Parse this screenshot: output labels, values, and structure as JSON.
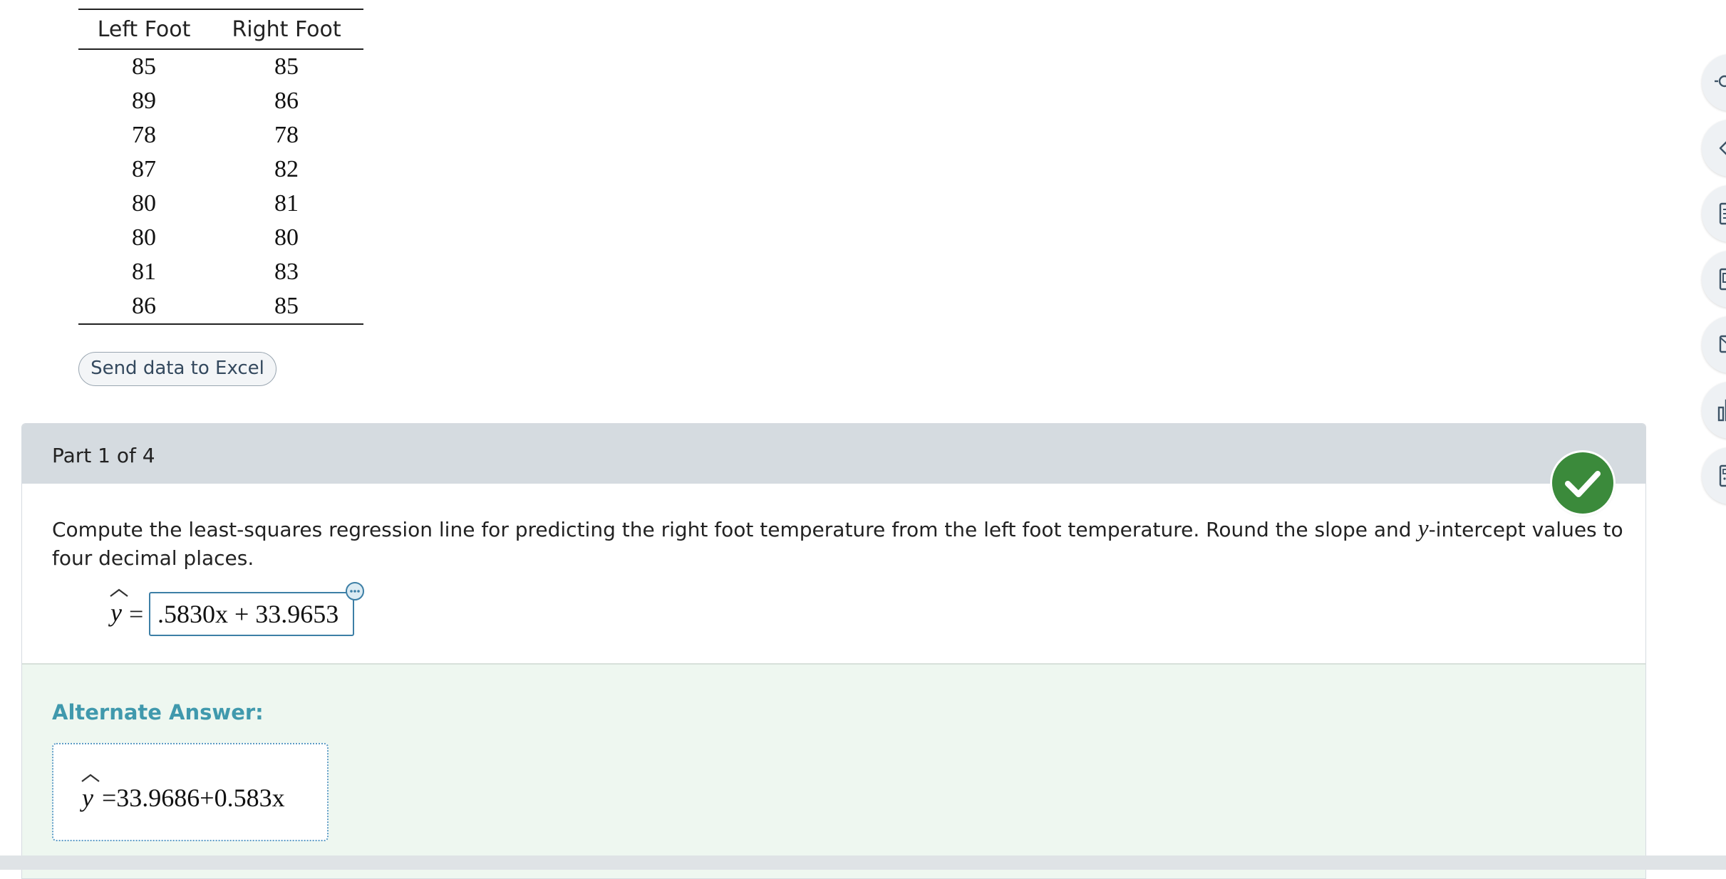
{
  "table": {
    "headers": [
      "Left Foot",
      "Right Foot"
    ],
    "rows": [
      [
        "85",
        "85"
      ],
      [
        "89",
        "86"
      ],
      [
        "78",
        "78"
      ],
      [
        "87",
        "82"
      ],
      [
        "80",
        "81"
      ],
      [
        "80",
        "80"
      ],
      [
        "81",
        "83"
      ],
      [
        "86",
        "85"
      ]
    ]
  },
  "excel_button": "Send data to Excel",
  "part": {
    "title": "Part 1 of 4",
    "question_before": "Compute the least-squares regression line for predicting the right foot temperature from the left foot temperature. Round the slope and ",
    "question_var": "y",
    "question_after": "-intercept values to four decimal places.",
    "answer_lhs": "y",
    "answer_eq": "=",
    "answer_value": ".5830x + 33.9653",
    "alternate_title": "Alternate Answer:",
    "alternate_lhs": "y",
    "alternate_rhs": "=33.9686+0.583x"
  },
  "colors": {
    "accent": "#3d7fa6",
    "success": "#3b8a3b",
    "header_bg": "#d5dbe0",
    "alt_bg": "#eef7f0",
    "alt_title": "#4099ad"
  },
  "toolbar_icons": [
    "search-icon",
    "tag-icon",
    "notes-icon",
    "book-icon",
    "mail-icon",
    "chart-icon",
    "calculator-icon"
  ]
}
